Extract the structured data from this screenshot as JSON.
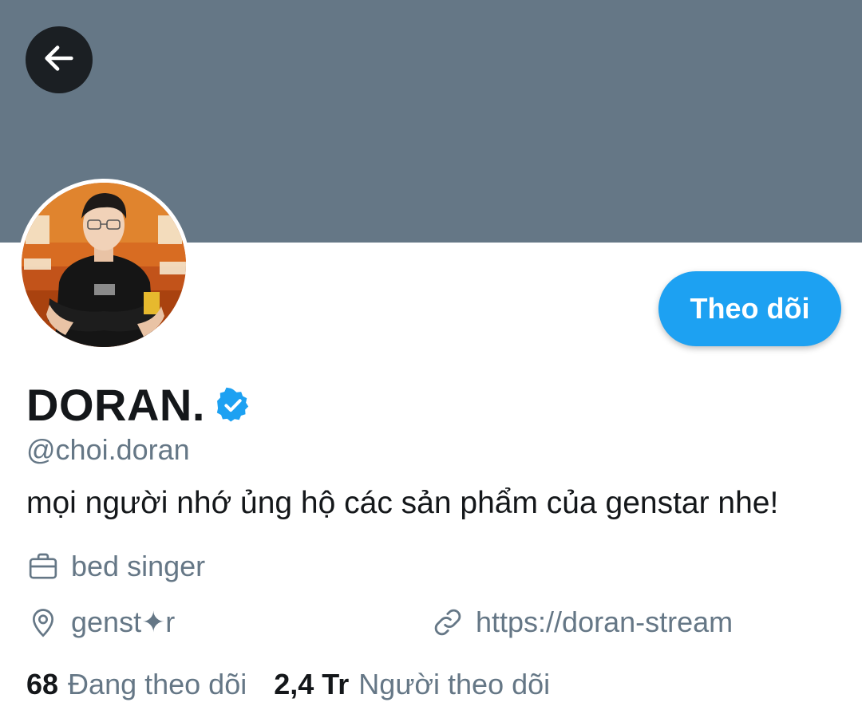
{
  "header": {
    "banner_color": "#657786",
    "back_icon": "arrow-left-icon"
  },
  "profile": {
    "display_name": "DORAN.",
    "verified_icon": "verified-badge-icon",
    "handle": "@choi.doran",
    "bio": "mọi người nhớ ủng hộ các sản phẩm của genstar nhe!",
    "follow_label": "Theo dõi",
    "accent_color": "#1da1f2"
  },
  "meta": {
    "job_icon": "briefcase-icon",
    "job": "bed singer",
    "location_icon": "location-pin-icon",
    "location": "genst✦r",
    "link_icon": "link-icon",
    "link": "https://doran-stream"
  },
  "stats": {
    "following_count": "68",
    "following_label": "Đang theo dõi",
    "followers_count": "2,4 Tr",
    "followers_label": "Người theo dõi"
  }
}
